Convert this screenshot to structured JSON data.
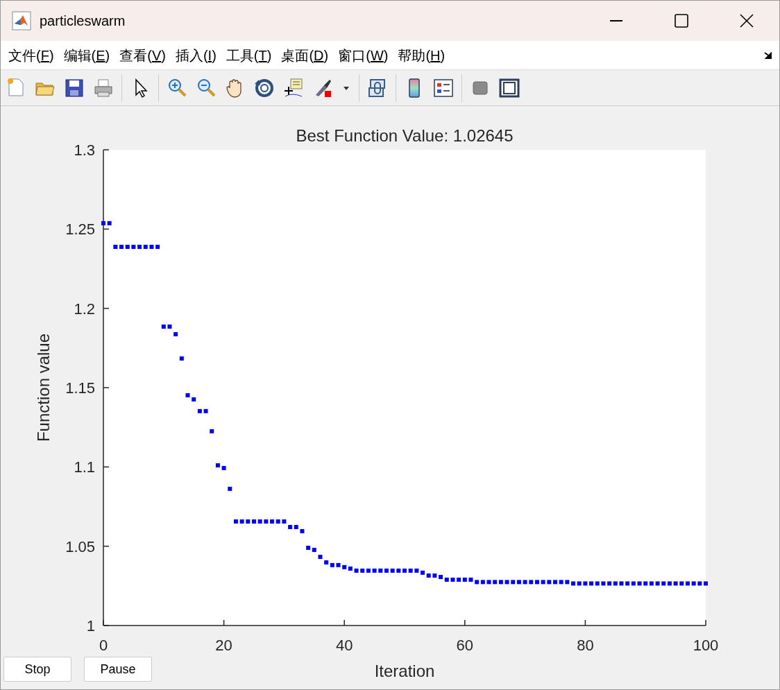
{
  "window": {
    "title": "particleswarm"
  },
  "menu": [
    {
      "label": "文件(F)"
    },
    {
      "label": "编辑(E)"
    },
    {
      "label": "查看(V)"
    },
    {
      "label": "插入(I)"
    },
    {
      "label": "工具(T)"
    },
    {
      "label": "桌面(D)"
    },
    {
      "label": "窗口(W)"
    },
    {
      "label": "帮助(H)"
    }
  ],
  "plot": {
    "chart_data": {
      "type": "scatter",
      "title": "Best Function Value: 1.02645",
      "xlabel": "Iteration",
      "ylabel": "Function value",
      "xlim": [
        0,
        100
      ],
      "ylim": [
        1,
        1.3
      ],
      "xticks": [
        0,
        20,
        40,
        60,
        80,
        100
      ],
      "yticks": [
        1,
        1.05,
        1.1,
        1.15,
        1.2,
        1.25,
        1.3
      ],
      "x": [
        0,
        1,
        2,
        3,
        4,
        5,
        6,
        7,
        8,
        9,
        10,
        11,
        12,
        13,
        14,
        15,
        16,
        17,
        18,
        19,
        20,
        21,
        22,
        23,
        24,
        25,
        26,
        27,
        28,
        29,
        30,
        31,
        32,
        33,
        34,
        35,
        36,
        37,
        38,
        39,
        40,
        41,
        42,
        43,
        44,
        45,
        46,
        47,
        48,
        49,
        50,
        51,
        52,
        53,
        54,
        55,
        56,
        57,
        58,
        59,
        60,
        61,
        62,
        63,
        64,
        65,
        66,
        67,
        68,
        69,
        70,
        71,
        72,
        73,
        74,
        75,
        76,
        77,
        78,
        79,
        80,
        81,
        82,
        83,
        84,
        85,
        86,
        87,
        88,
        89,
        90,
        91,
        92,
        93,
        94,
        95,
        96,
        97,
        98,
        99,
        100
      ],
      "series": [
        {
          "color": "#0000ff",
          "values": [
            1.2537,
            1.2537,
            1.2388,
            1.2388,
            1.2388,
            1.2388,
            1.2388,
            1.2388,
            1.2388,
            1.2388,
            1.1885,
            1.1885,
            1.1837,
            1.1684,
            1.1452,
            1.1426,
            1.1352,
            1.1352,
            1.1225,
            1.101,
            1.0993,
            1.0862,
            1.0656,
            1.0656,
            1.0656,
            1.0656,
            1.0656,
            1.0656,
            1.0656,
            1.0656,
            1.0656,
            1.0621,
            1.0621,
            1.0595,
            1.049,
            1.0477,
            1.0433,
            1.0398,
            1.0381,
            1.0381,
            1.0368,
            1.0359,
            1.0346,
            1.0346,
            1.0346,
            1.0346,
            1.0346,
            1.0346,
            1.0346,
            1.0346,
            1.0346,
            1.0346,
            1.0346,
            1.0333,
            1.0315,
            1.0315,
            1.0306,
            1.0289,
            1.0289,
            1.0289,
            1.0289,
            1.0289,
            1.0274,
            1.0274,
            1.0274,
            1.0274,
            1.0274,
            1.0274,
            1.0274,
            1.0274,
            1.0274,
            1.0274,
            1.0274,
            1.0274,
            1.0274,
            1.0274,
            1.0274,
            1.0274,
            1.0265,
            1.0265,
            1.0265,
            1.0265,
            1.0265,
            1.0265,
            1.0265,
            1.0265,
            1.0265,
            1.0265,
            1.0265,
            1.0265,
            1.0265,
            1.0265,
            1.0265,
            1.0265,
            1.0265,
            1.0265,
            1.0265,
            1.0265,
            1.0265,
            1.0265,
            1.0265
          ]
        }
      ]
    }
  },
  "buttons": [
    {
      "label": "Stop"
    },
    {
      "label": "Pause"
    }
  ]
}
